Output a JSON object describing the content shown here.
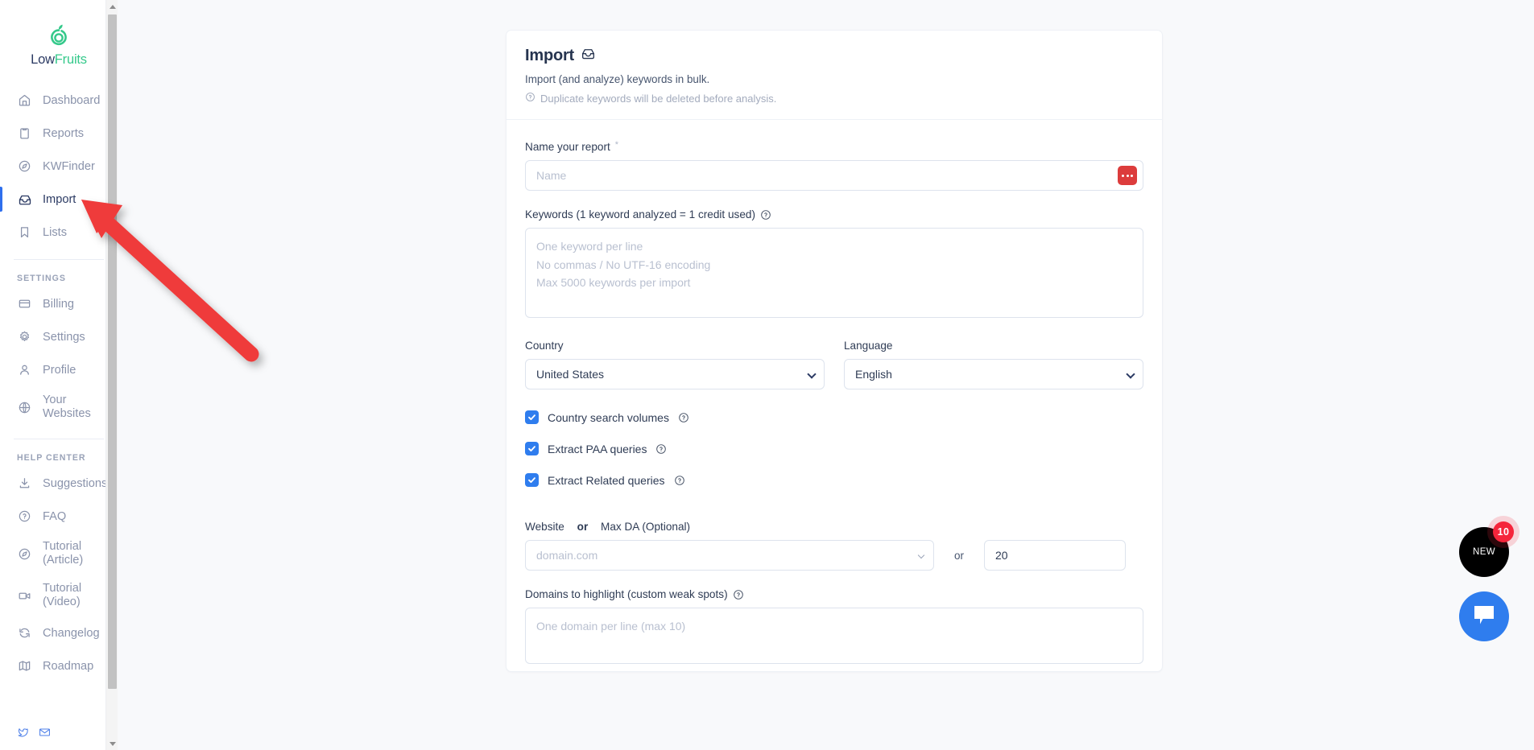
{
  "brand": {
    "name_part1": "Low",
    "name_part2": "Fruits",
    "color_primary": "#35c98b",
    "color_dark": "#2b3a63"
  },
  "sidebar": {
    "items": [
      {
        "label": "Dashboard",
        "icon": "home-icon",
        "active": false
      },
      {
        "label": "Reports",
        "icon": "clipboard-icon",
        "active": false
      },
      {
        "label": "KWFinder",
        "icon": "compass-icon",
        "active": false
      },
      {
        "label": "Import",
        "icon": "inbox-icon",
        "active": true
      },
      {
        "label": "Lists",
        "icon": "bookmark-icon",
        "active": false
      }
    ],
    "settings_heading": "SETTINGS",
    "settings_items": [
      {
        "label": "Billing",
        "icon": "credit-card-icon"
      },
      {
        "label": "Settings",
        "icon": "gear-icon"
      },
      {
        "label": "Profile",
        "icon": "user-icon"
      },
      {
        "label": "Your Websites",
        "icon": "globe-icon"
      }
    ],
    "help_heading": "HELP CENTER",
    "help_items": [
      {
        "label": "Suggestions",
        "icon": "download-icon"
      },
      {
        "label": "FAQ",
        "icon": "question-circle-icon"
      },
      {
        "label": "Tutorial (Article)",
        "icon": "compass-icon"
      },
      {
        "label": "Tutorial (Video)",
        "icon": "video-camera-icon"
      },
      {
        "label": "Changelog",
        "icon": "refresh-icon"
      },
      {
        "label": "Roadmap",
        "icon": "map-icon"
      }
    ],
    "social": [
      {
        "icon": "twitter-icon"
      },
      {
        "icon": "envelope-icon"
      }
    ]
  },
  "card": {
    "title": "Import",
    "title_icon": "inbox-icon",
    "subtitle": "Import (and analyze) keywords in bulk.",
    "note": "Duplicate keywords will be deleted before analysis.",
    "note_icon": "question-circle-icon"
  },
  "form": {
    "name": {
      "label": "Name your report",
      "required_mark": "*",
      "placeholder": "Name",
      "value": "",
      "action_icon": "ellipsis-icon",
      "action_color": "#dc3c3c"
    },
    "keywords": {
      "label": "Keywords (1 keyword analyzed = 1 credit used)",
      "help_icon": "question-circle-icon",
      "placeholder": "One keyword per line\nNo commas / No UTF-16 encoding\nMax 5000 keywords per import",
      "value": ""
    },
    "country": {
      "label": "Country",
      "selected": "United States",
      "options": [
        "United States"
      ]
    },
    "language": {
      "label": "Language",
      "selected": "English",
      "options": [
        "English"
      ]
    },
    "checkboxes": [
      {
        "label": "Country search volumes",
        "checked": true,
        "help_icon": "question-circle-icon"
      },
      {
        "label": "Extract PAA queries",
        "checked": true,
        "help_icon": "question-circle-icon"
      },
      {
        "label": "Extract Related queries",
        "checked": true,
        "help_icon": "question-circle-icon"
      }
    ],
    "website": {
      "label_part1": "Website",
      "label_or": "or",
      "label_part2": "Max DA (Optional)",
      "placeholder": "domain.com",
      "value": "",
      "separator": "or",
      "max_da_value": "20"
    },
    "domains": {
      "label": "Domains to highlight (custom weak spots)",
      "help_icon": "question-circle-icon",
      "placeholder": "One domain per line (max 10)",
      "value": ""
    }
  },
  "widgets": {
    "new_label": "NEW",
    "new_badge": "10",
    "new_bg": "#000000",
    "badge_bg": "#f5253b",
    "chat_icon": "chat-bubble-icon",
    "chat_bg": "#2f7dee"
  },
  "annotation": {
    "arrow_color": "#ef3b3b"
  }
}
